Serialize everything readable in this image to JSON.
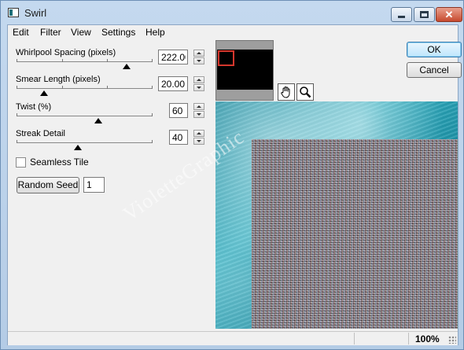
{
  "window": {
    "title": "Swirl"
  },
  "menu": [
    "Edit",
    "Filter",
    "View",
    "Settings",
    "Help"
  ],
  "params": [
    {
      "label": "Whirlpool Spacing (pixels)",
      "value": "222.00",
      "level": 0.81
    },
    {
      "label": "Smear Length (pixels)",
      "value": "20.00",
      "level": 0.2
    },
    {
      "label": "Twist (%)",
      "value": "60",
      "level": 0.6
    },
    {
      "label": "Streak Detail",
      "value": "40",
      "level": 0.45
    }
  ],
  "seamless_tile": {
    "label": "Seamless Tile",
    "checked": false
  },
  "random_seed": {
    "button_label": "Random Seed",
    "value": "1"
  },
  "buttons": {
    "ok": "OK",
    "cancel": "Cancel"
  },
  "preview": {
    "watermark": "VioletteGraphic"
  },
  "status": {
    "zoom": "100%"
  },
  "colors": {
    "preview_base": "#1d93a8",
    "nav_rect": "#d5372d"
  }
}
